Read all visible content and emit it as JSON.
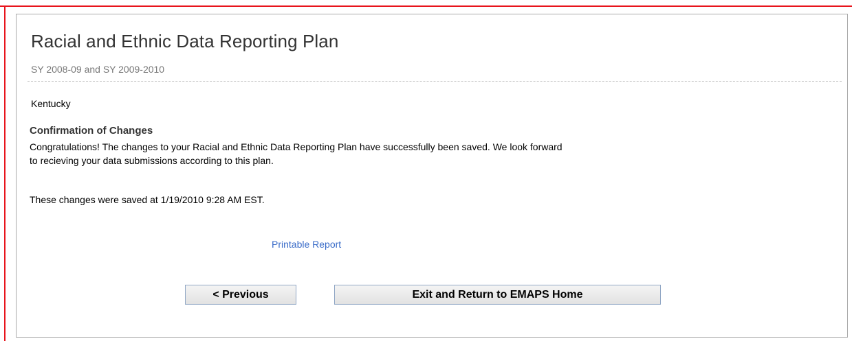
{
  "page": {
    "title": "Racial and Ethnic Data Reporting Plan",
    "subtitle": "SY 2008-09 and SY 2009-2010",
    "state": "Kentucky"
  },
  "confirmation": {
    "heading": "Confirmation of Changes",
    "message_line1": "Congratulations! The changes to your Racial and Ethnic Data Reporting Plan have successfully been saved. We look forward",
    "message_line2": "to recieving your data submissions according to this plan.",
    "saved_at": "These changes were saved at 1/19/2010 9:28 AM EST."
  },
  "links": {
    "printable_report": "Printable Report"
  },
  "buttons": {
    "previous": "< Previous",
    "exit": "Exit and Return to EMAPS Home"
  },
  "colors": {
    "frame_accent": "#e8141c",
    "link": "#3a6cc8",
    "button_border": "#8fa6c4"
  }
}
